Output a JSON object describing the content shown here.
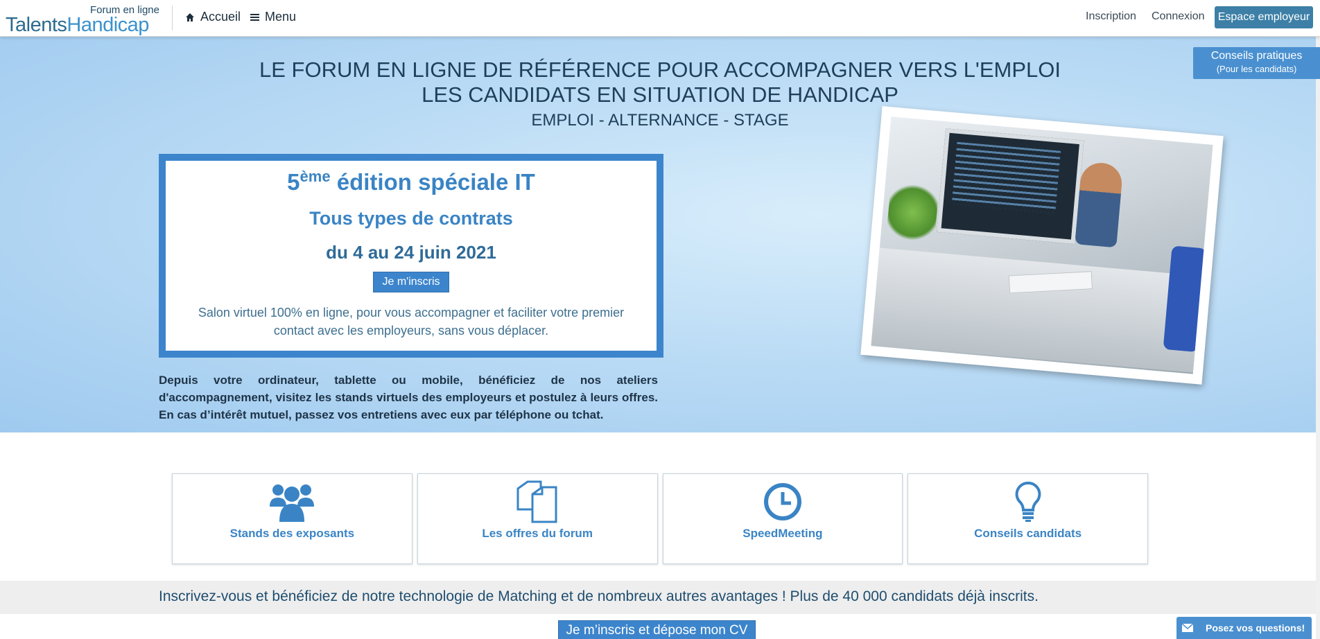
{
  "header": {
    "logo_small": "Forum en ligne",
    "logo_talents": "Talents",
    "logo_handicap": "Handicap",
    "nav": {
      "home": "Accueil",
      "menu": "Menu"
    },
    "links": {
      "inscription": "Inscription",
      "connexion": "Connexion",
      "employer": "Espace employeur"
    }
  },
  "side_tab": {
    "title": "Conseils pratiques",
    "subtitle": "(Pour les candidats)"
  },
  "hero": {
    "headline_1": "LE FORUM EN LIGNE DE RÉFÉRENCE POUR ACCOMPAGNER VERS L'EMPLOI",
    "headline_2": "LES CANDIDATS EN SITUATION DE HANDICAP",
    "subline": "EMPLOI - ALTERNANCE - STAGE",
    "edition": {
      "number": "5",
      "suffix": "ème",
      "title_rest": " édition spéciale IT",
      "contracts": "Tous types de contrats",
      "dates": "du 4 au 24 juin 2021",
      "button": "Je m'inscris",
      "description": "Salon virtuel 100% en ligne, pour vous accompagner et faciliter votre premier contact avec les employeurs, sans vous déplacer."
    },
    "body": "Depuis votre ordinateur, tablette ou mobile, bénéficiez de nos ateliers d'accompagnement, visitez les stands virtuels des employeurs et postulez à leurs offres. En cas d’intérêt mutuel, passez vos entretiens avec eux par téléphone ou tchat."
  },
  "tiles": [
    {
      "label": "Stands des exposants",
      "icon": "users-icon"
    },
    {
      "label": "Les offres du forum",
      "icon": "documents-icon"
    },
    {
      "label": "SpeedMeeting",
      "icon": "clock-icon"
    },
    {
      "label": "Conseils candidats",
      "icon": "lightbulb-icon"
    }
  ],
  "band": {
    "text": "Inscrivez-vous et bénéficiez de notre technologie de Matching et de nombreux autres avantages ! Plus de 40 000 candidats déjà inscrits."
  },
  "cta": {
    "label": "Je m’inscris et dépose mon CV"
  },
  "chat": {
    "label": "Posez vos questions!"
  },
  "colors": {
    "primary": "#3c85cc",
    "dark_text": "#1e3f5a",
    "hero_bg": "#bcdcf5"
  }
}
